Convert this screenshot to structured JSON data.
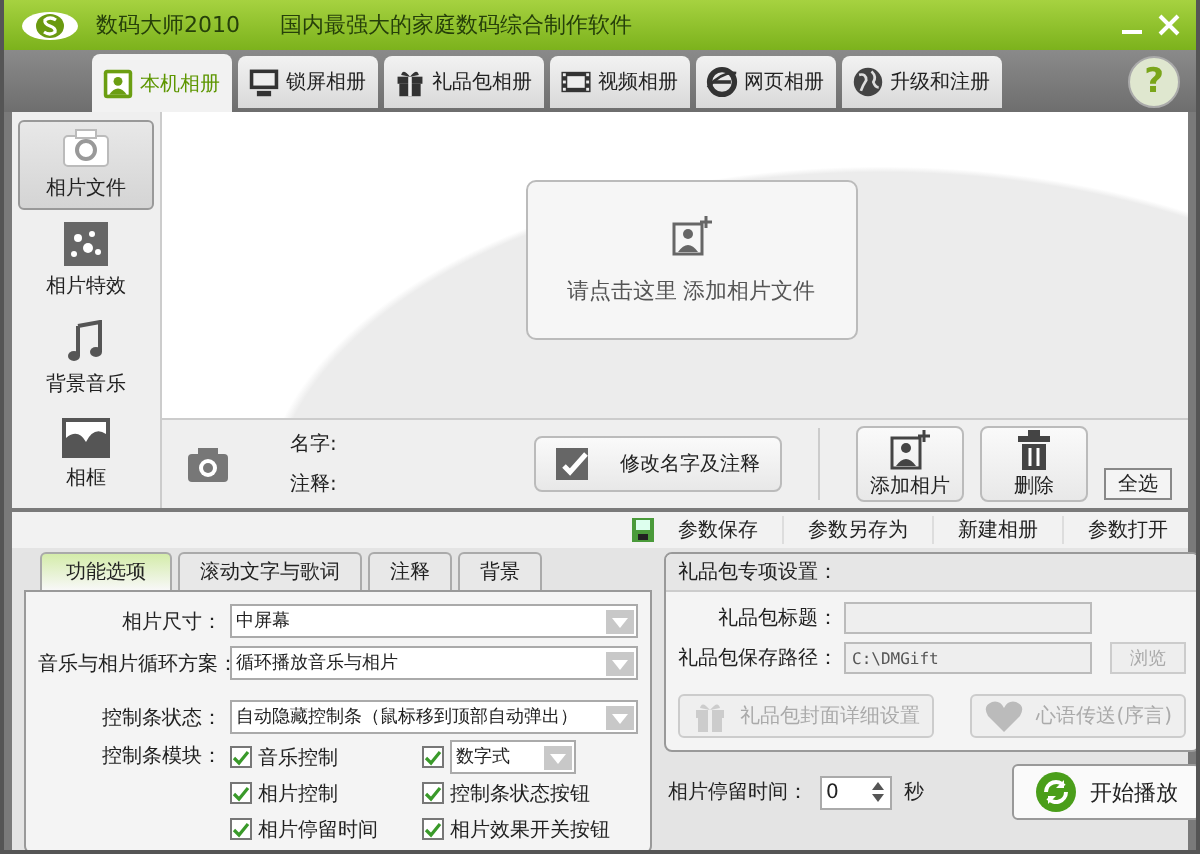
{
  "window": {
    "title": "数码大师2010",
    "subtitle": "国内最强大的家庭数码综合制作软件"
  },
  "tabs": [
    {
      "label": "本机相册",
      "selected": true
    },
    {
      "label": "锁屏相册",
      "selected": false
    },
    {
      "label": "礼品包相册",
      "selected": false
    },
    {
      "label": "视频相册",
      "selected": false
    },
    {
      "label": "网页相册",
      "selected": false
    },
    {
      "label": "升级和注册",
      "selected": false
    }
  ],
  "sidebar": {
    "items": [
      {
        "label": "相片文件",
        "selected": true
      },
      {
        "label": "相片特效",
        "selected": false
      },
      {
        "label": "背景音乐",
        "selected": false
      },
      {
        "label": "相框",
        "selected": false
      }
    ]
  },
  "drop_area": {
    "text": "请点击这里  添加相片文件"
  },
  "help": "?",
  "photo_info": {
    "name_label": "名字:",
    "note_label": "注释:"
  },
  "edit_button": "修改名字及注释",
  "photo_buttons": [
    "添加相片",
    "删除"
  ],
  "select_all": "全选",
  "toolbar": [
    "参数保存",
    "参数另存为",
    "新建相册",
    "参数打开"
  ],
  "option_tabs": [
    {
      "label": "功能选项",
      "selected": true
    },
    {
      "label": "滚动文字与歌词",
      "selected": false
    },
    {
      "label": "注释",
      "selected": false
    },
    {
      "label": "背景",
      "selected": false
    }
  ],
  "options": [
    {
      "label": "相片尺寸：",
      "value": "中屏幕"
    },
    {
      "label": "音乐与相片循环方案：",
      "value": "循环播放音乐与相片"
    },
    {
      "label": "控制条状态：",
      "value": "自动隐藏控制条（鼠标移到顶部自动弹出）"
    }
  ],
  "modules_label": "控制条模块：",
  "modules": [
    {
      "kind": "check",
      "label": "音乐控制",
      "checked": true
    },
    {
      "kind": "select",
      "value": "数字式",
      "checked": true
    },
    {
      "kind": "check",
      "label": "相片控制",
      "checked": true
    },
    {
      "kind": "check",
      "label": "控制条状态按钮",
      "checked": true
    },
    {
      "kind": "check",
      "label": "相片停留时间",
      "checked": true
    },
    {
      "kind": "check",
      "label": "相片效果开关按钮",
      "checked": true
    }
  ],
  "gift": {
    "title": "礼品包专项设置：",
    "title_label": "礼品包标题：",
    "path_label": "礼品包保存路径：",
    "path_value": "C:\\DMGift",
    "browse": {
      "label": "浏览",
      "disabled": true
    },
    "buttons": [
      {
        "label": "礼品包封面详细设置",
        "disabled": true
      },
      {
        "label": "心语传送(序言)",
        "disabled": true
      }
    ]
  },
  "footer": {
    "label": "相片停留时间：",
    "value": "0",
    "unit": "秒",
    "play": "开始播放"
  }
}
